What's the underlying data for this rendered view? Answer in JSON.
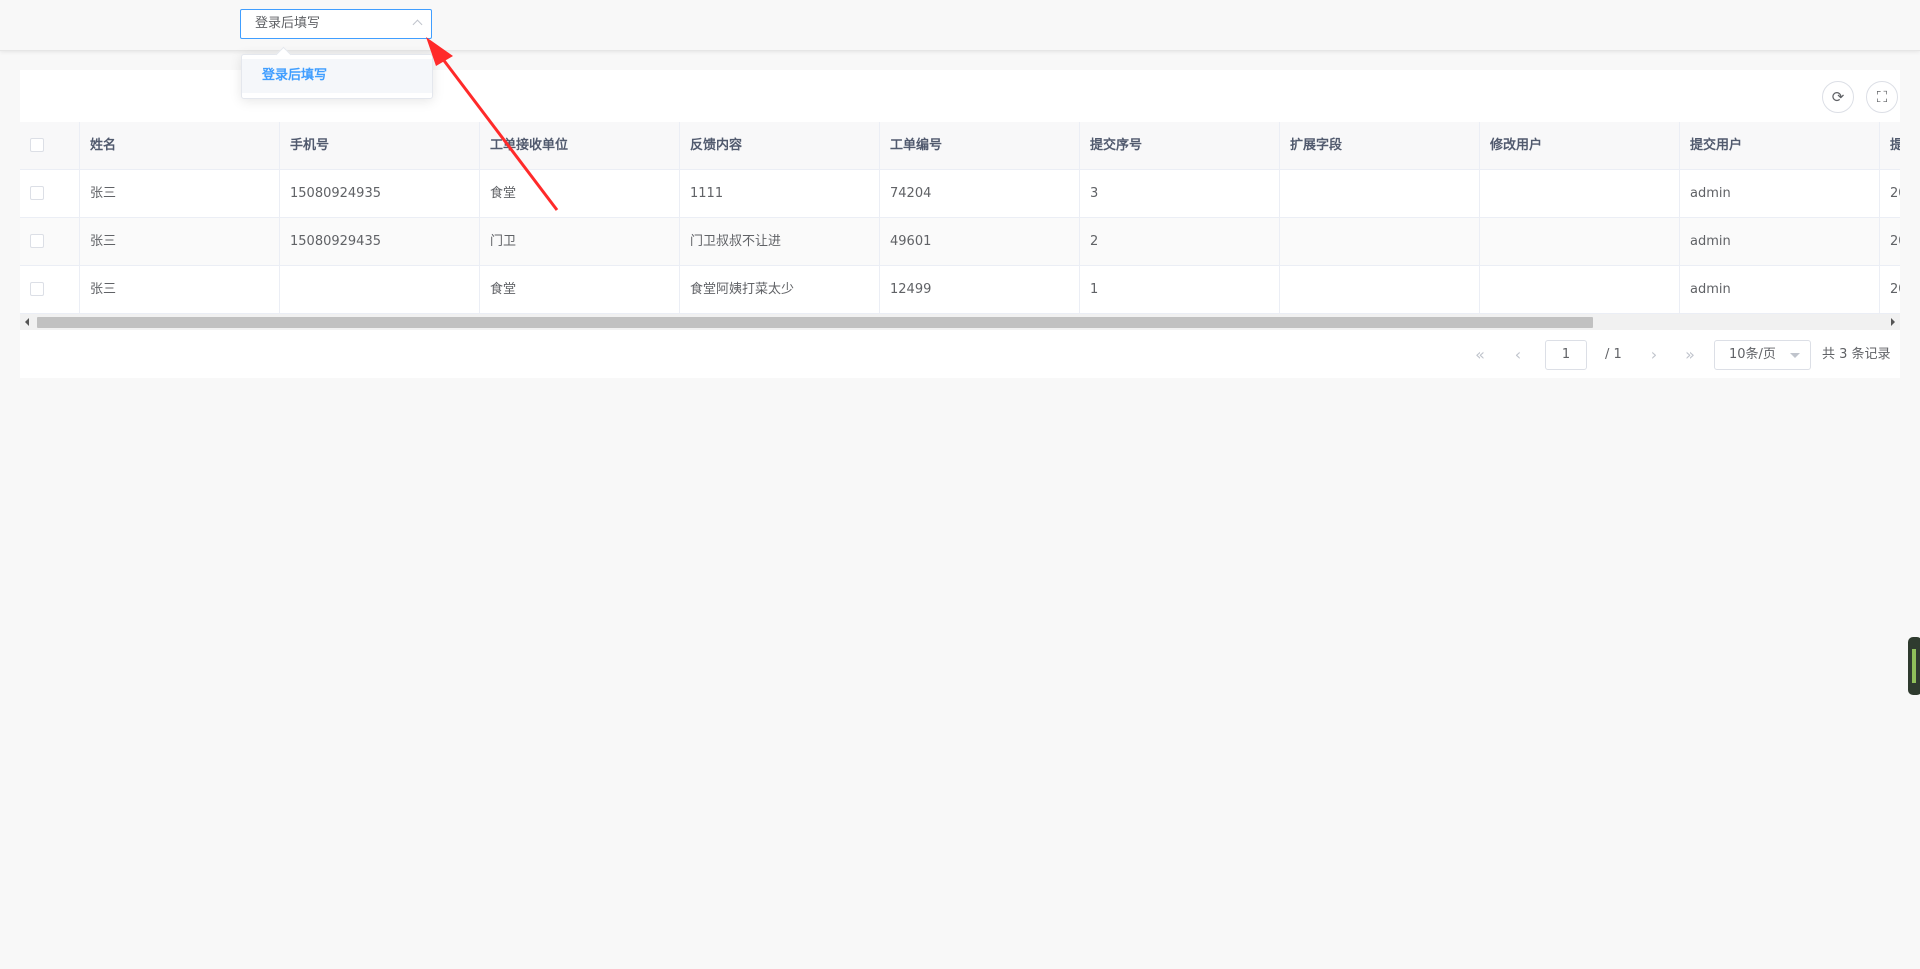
{
  "select": {
    "value": "登录后填写"
  },
  "dropdown": {
    "options": [
      "登录后填写"
    ]
  },
  "toolbar": {
    "refresh_icon": "refresh-icon",
    "fullscreen_icon": "fullscreen-icon"
  },
  "table": {
    "columns": [
      "姓名",
      "手机号",
      "工单接收单位",
      "反馈内容",
      "工单编号",
      "提交序号",
      "扩展字段",
      "修改用户",
      "提交用户",
      "提"
    ],
    "rows": [
      [
        "张三",
        "15080924935",
        "食堂",
        "1111",
        "74204",
        "3",
        "",
        "",
        "admin",
        "20"
      ],
      [
        "张三",
        "15080929435",
        "门卫",
        "门卫叔叔不让进",
        "49601",
        "2",
        "",
        "",
        "admin",
        "20"
      ],
      [
        "张三",
        "",
        "食堂",
        "食堂阿姨打菜太少",
        "12499",
        "1",
        "",
        "",
        "admin",
        "20"
      ]
    ]
  },
  "pagination": {
    "current_page": "1",
    "total_pages": "/ 1",
    "page_size": "10条/页",
    "total_text": "共 3 条记录"
  },
  "colors": {
    "accent": "#409eff",
    "annotation_arrow": "#ff2a2a"
  }
}
